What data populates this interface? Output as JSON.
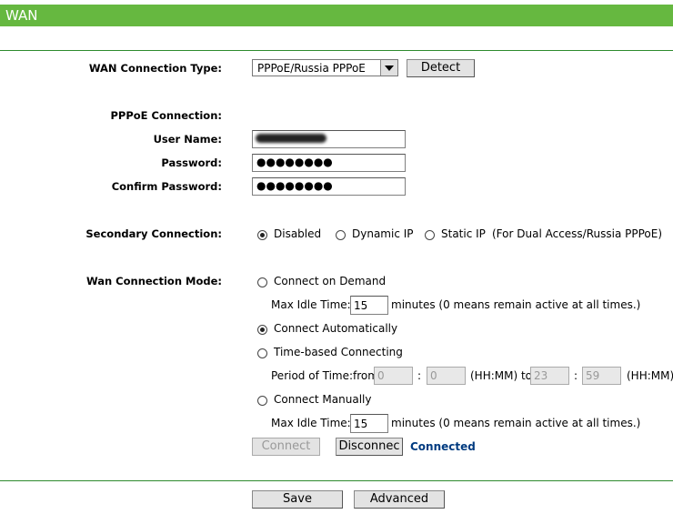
{
  "page": {
    "title": "WAN"
  },
  "conn_type": {
    "label": "WAN Connection Type:",
    "value": "PPPoE/Russia PPPoE",
    "detect": "Detect"
  },
  "pppoe": {
    "section": "PPPoE Connection:",
    "username_label": "User Name:",
    "password_label": "Password:",
    "password_mask": "●●●●●●●●",
    "confirm_label": "Confirm Password:",
    "confirm_mask": "●●●●●●●●"
  },
  "secondary": {
    "label": "Secondary Connection:",
    "disabled": "Disabled",
    "dynamic": "Dynamic IP",
    "static": "Static IP",
    "note": "(For Dual Access/Russia PPPoE)",
    "selected": "Disabled"
  },
  "mode": {
    "label": "Wan Connection Mode:",
    "on_demand": "Connect on Demand",
    "idle1_label": "Max Idle Time:",
    "idle1_value": "15",
    "idle1_note": "minutes (0 means remain active at all times.)",
    "auto": "Connect Automatically",
    "time_based": "Time-based Connecting",
    "period_label": "Period of Time:from",
    "from_h": "0",
    "from_m": "0",
    "hhmm1": "(HH:MM) to",
    "to_h": "23",
    "to_m": "59",
    "hhmm2": "(HH:MM)",
    "colon": ":",
    "manual": "Connect Manually",
    "idle2_label": "Max Idle Time:",
    "idle2_value": "15",
    "idle2_note": "minutes (0 means remain active at all times.)",
    "selected": "Connect Automatically"
  },
  "actions": {
    "connect": "Connect",
    "disconnect": "Disconnec",
    "status": "Connected"
  },
  "footer": {
    "save": "Save",
    "advanced": "Advanced"
  }
}
